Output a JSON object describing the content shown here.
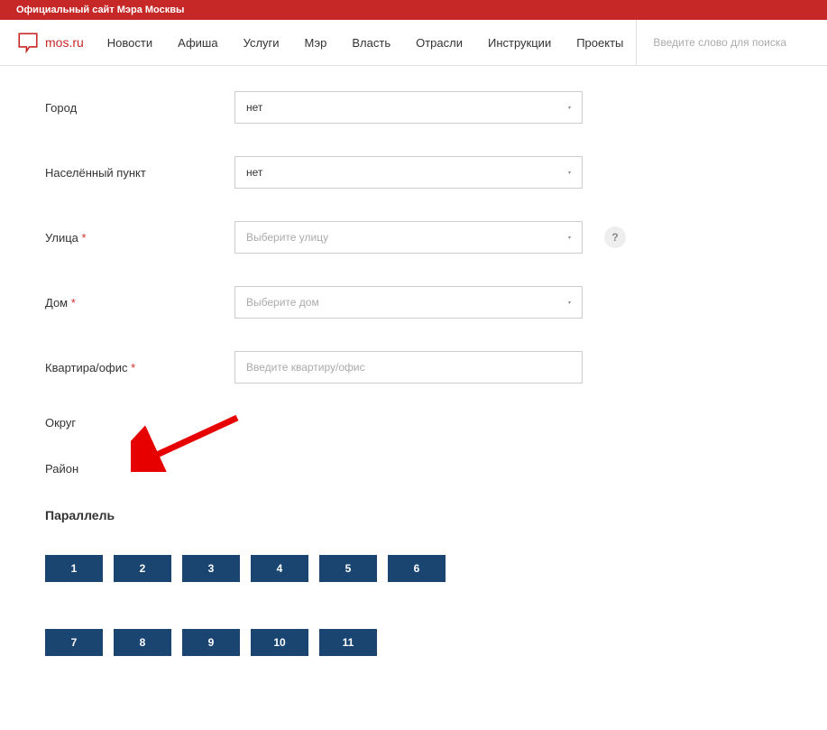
{
  "topbar": {
    "text": "Официальный сайт Мэра Москвы"
  },
  "logo": {
    "text": "mos.ru"
  },
  "nav": {
    "items": [
      "Новости",
      "Афиша",
      "Услуги",
      "Мэр",
      "Власть",
      "Отрасли",
      "Инструкции",
      "Проекты"
    ]
  },
  "search": {
    "placeholder": "Введите слово для поиска"
  },
  "form": {
    "city": {
      "label": "Город",
      "value": "нет"
    },
    "settlement": {
      "label": "Населённый пункт",
      "value": "нет"
    },
    "street": {
      "label": "Улица",
      "required": "*",
      "placeholder": "Выберите улицу"
    },
    "house": {
      "label": "Дом",
      "required": "*",
      "placeholder": "Выберите дом"
    },
    "apartment": {
      "label": "Квартира/офис",
      "required": "*",
      "placeholder": "Введите квартиру/офис"
    },
    "okrug": {
      "label": "Округ"
    },
    "district": {
      "label": "Район"
    }
  },
  "parallel": {
    "title": "Параллель",
    "row1": [
      "1",
      "2",
      "3",
      "4",
      "5",
      "6"
    ],
    "row2": [
      "7",
      "8",
      "9",
      "10",
      "11"
    ]
  },
  "help": {
    "symbol": "?"
  }
}
